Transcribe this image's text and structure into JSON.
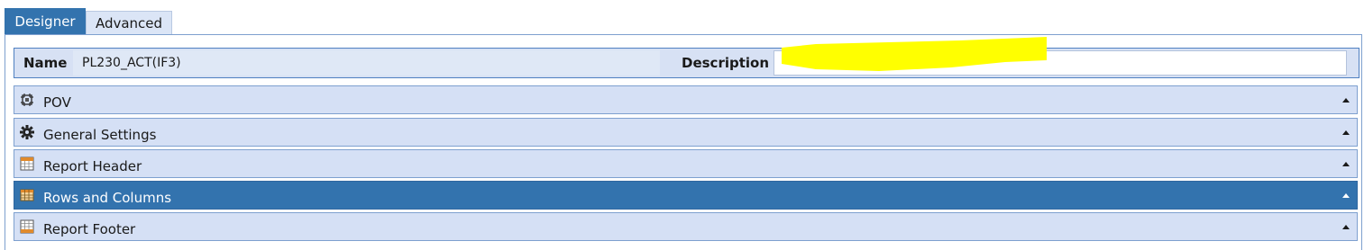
{
  "tabs": [
    {
      "label": "Designer",
      "active": true
    },
    {
      "label": "Advanced",
      "active": false
    }
  ],
  "name_row": {
    "name_label": "Name",
    "name_value": "PL230_ACT(IF3)",
    "description_label": "Description",
    "description_value": ""
  },
  "sections": [
    {
      "title": "POV",
      "icon": "pov-icon",
      "active": false
    },
    {
      "title": "General Settings",
      "icon": "gear-icon",
      "active": false
    },
    {
      "title": "Report Header",
      "icon": "report-header-icon",
      "active": false
    },
    {
      "title": "Rows and Columns",
      "icon": "rows-columns-icon",
      "active": true
    },
    {
      "title": "Report Footer",
      "icon": "report-footer-icon",
      "active": false
    }
  ],
  "colors": {
    "accent": "#3373ae",
    "section_bg": "#d5e0f5",
    "redaction": "#ffff00"
  }
}
